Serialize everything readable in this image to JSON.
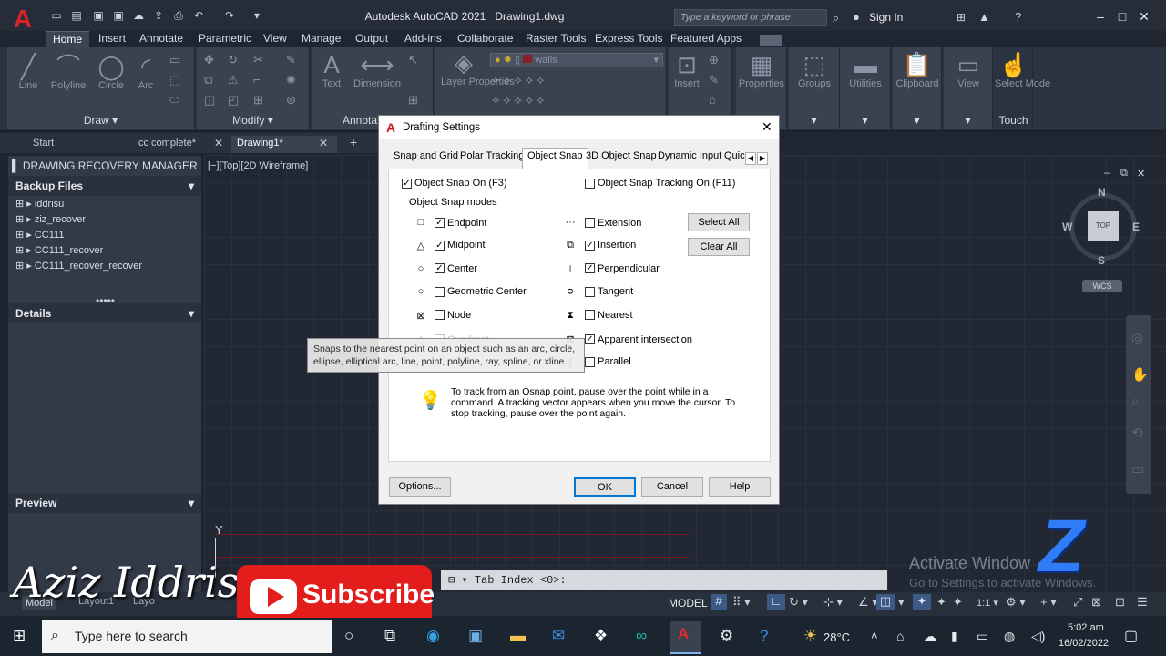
{
  "app": {
    "title": "Autodesk AutoCAD 2021",
    "document": "Drawing1.dwg",
    "logo": "A",
    "search_placeholder": "Type a keyword or phrase",
    "sign_in": "Sign In"
  },
  "ribbon_tabs": [
    "Home",
    "Insert",
    "Annotate",
    "Parametric",
    "View",
    "Manage",
    "Output",
    "Add-ins",
    "Collaborate",
    "Raster Tools",
    "Express Tools",
    "Featured Apps"
  ],
  "ribbon": {
    "draw": {
      "label": "Draw",
      "tools": [
        "Line",
        "Polyline",
        "Circle",
        "Arc"
      ]
    },
    "modify": {
      "label": "Modify"
    },
    "annotation": {
      "label": "Annotat",
      "tools": [
        "Text",
        "Dimension"
      ]
    },
    "layers": {
      "layer_properties": "Layer Properties",
      "current_layer": "walls"
    },
    "block": {
      "insert": "Insert"
    },
    "right": [
      "Properties",
      "Groups",
      "Utilities",
      "Clipboard",
      "View",
      "Select Mode"
    ],
    "touch": "Touch"
  },
  "file_tabs": [
    {
      "label": "Start"
    },
    {
      "label": "cc complete*"
    },
    {
      "label": "Drawing1*"
    }
  ],
  "file_tab_add": "+",
  "recovery": {
    "title": "DRAWING RECOVERY MANAGER",
    "backup_header": "Backup Files",
    "files": [
      "iddrisu",
      "ziz_recover",
      "CC111",
      "CC111_recover",
      "CC111_recover_recover"
    ],
    "details": "Details",
    "preview": "Preview"
  },
  "viewport_label": "[−][Top][2D Wireframe]",
  "viewcube": {
    "n": "N",
    "s": "S",
    "e": "E",
    "w": "W",
    "top": "TOP",
    "wcs": "WCS"
  },
  "dialog": {
    "title": "Drafting Settings",
    "tabs": [
      "Snap and Grid",
      "Polar Tracking",
      "Object Snap",
      "3D Object Snap",
      "Dynamic Input",
      "Quic"
    ],
    "active_tab": "Object Snap",
    "osnap_on": "Object Snap On (F3)",
    "osnap_tracking": "Object Snap Tracking On (F11)",
    "modes_label": "Object Snap modes",
    "left_modes": [
      {
        "label": "Endpoint",
        "checked": true,
        "symbol": "□"
      },
      {
        "label": "Midpoint",
        "checked": true,
        "symbol": "△"
      },
      {
        "label": "Center",
        "checked": true,
        "symbol": "○"
      },
      {
        "label": "Geometric Center",
        "checked": false,
        "symbol": "○"
      },
      {
        "label": "Node",
        "checked": false,
        "symbol": "⊠"
      },
      {
        "label": "Quadrant",
        "checked": false,
        "symbol": "◇"
      }
    ],
    "right_modes": [
      {
        "label": "Extension",
        "checked": false,
        "symbol": "···"
      },
      {
        "label": "Insertion",
        "checked": true,
        "symbol": "⧉"
      },
      {
        "label": "Perpendicular",
        "checked": true,
        "symbol": "⊥"
      },
      {
        "label": "Tangent",
        "checked": false,
        "symbol": "ᴑ"
      },
      {
        "label": "Nearest",
        "checked": false,
        "symbol": "⧗"
      },
      {
        "label": "Apparent intersection",
        "checked": true,
        "symbol": "⊠"
      },
      {
        "label": "Parallel",
        "checked": false,
        "symbol": "∥"
      }
    ],
    "select_all": "Select All",
    "clear_all": "Clear All",
    "hint": "To track from an Osnap point, pause over the point while in a command.  A tracking vector appears when you move the cursor.  To stop tracking, pause over the point again.",
    "options": "Options...",
    "ok": "OK",
    "cancel": "Cancel",
    "help": "Help"
  },
  "tooltip": "Snaps to the nearest point on an object such as an arc, circle, ellipse, elliptical arc, line, point, polyline, ray, spline, or xline.",
  "command_line": "Tab Index <0>:",
  "status": {
    "model": "MODEL",
    "layout_tabs": [
      "Model",
      "Layout1",
      "Layo"
    ],
    "scale": "1:1"
  },
  "watermark": {
    "line1": "Activate Window",
    "line2": "Go to Settings to activate Windows."
  },
  "overlay": {
    "author": "Aziz Iddrisu",
    "subscribe": "Subscribe"
  },
  "taskbar": {
    "search_placeholder": "Type here to search",
    "weather": "28°C",
    "time": "5:02 am",
    "date": "16/02/2022"
  }
}
